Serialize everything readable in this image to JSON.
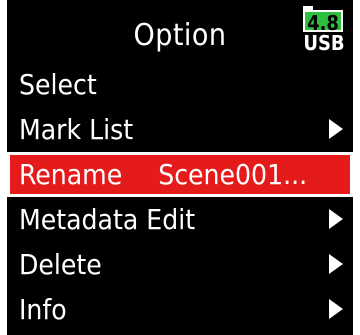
{
  "header": {
    "title": "Option",
    "battery": {
      "level": "4.8",
      "source": "USB",
      "accent_color": "#2fbf3f"
    }
  },
  "menu": {
    "selected_index": 2,
    "highlight_color": "#e51a1a",
    "items": [
      {
        "label": "Select",
        "value": "",
        "has_submenu": false
      },
      {
        "label": "Mark List",
        "value": "",
        "has_submenu": true
      },
      {
        "label": "Rename",
        "value": "Scene001...",
        "has_submenu": false
      },
      {
        "label": "Metadata Edit",
        "value": "",
        "has_submenu": true
      },
      {
        "label": "Delete",
        "value": "",
        "has_submenu": true
      },
      {
        "label": "Info",
        "value": "",
        "has_submenu": true
      }
    ]
  }
}
